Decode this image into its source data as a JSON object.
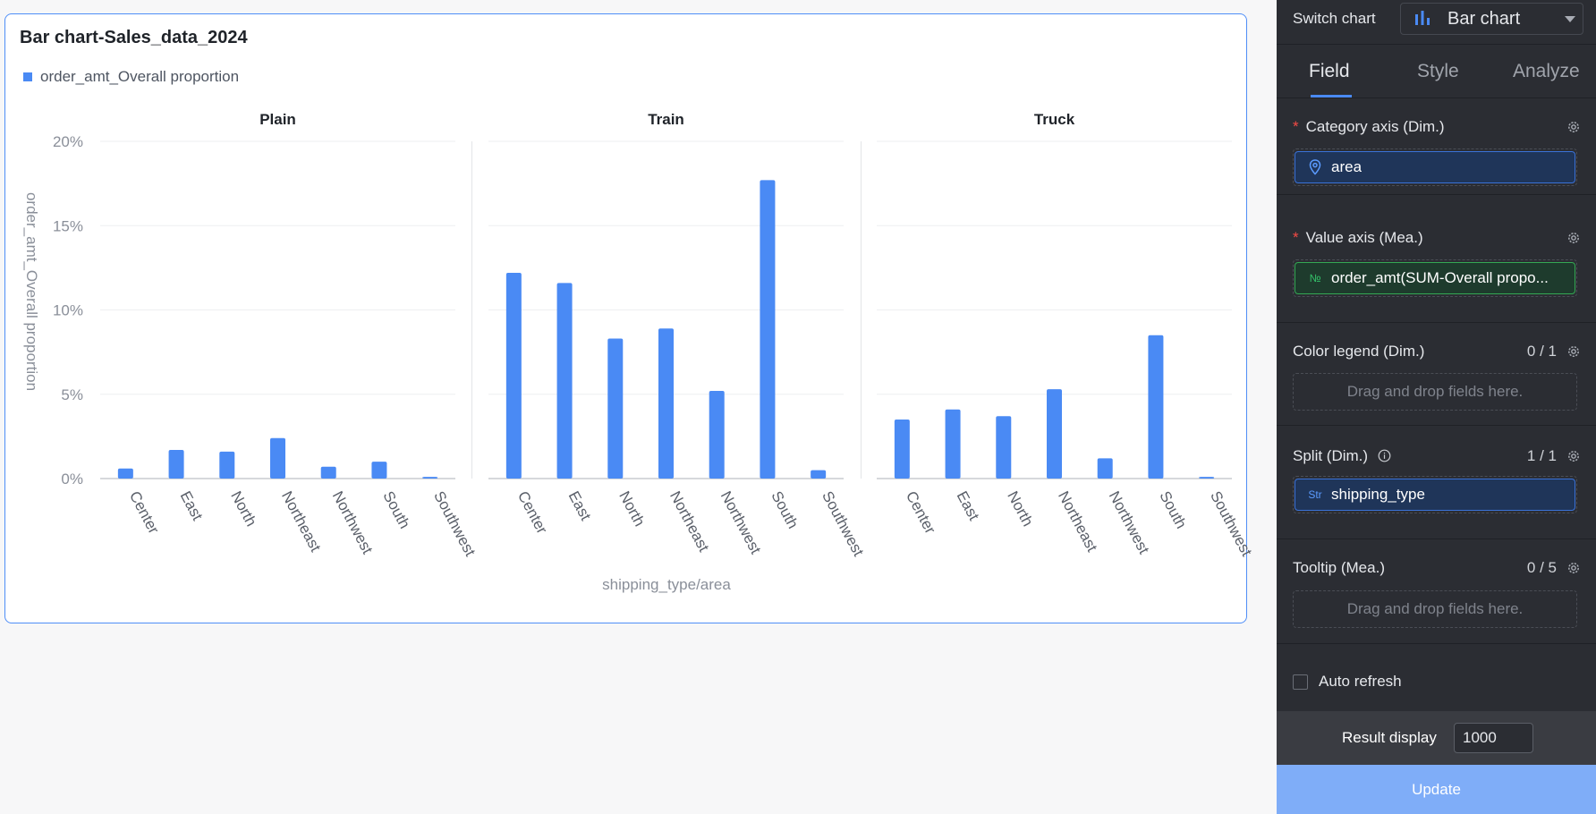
{
  "card": {
    "title": "Bar chart-Sales_data_2024",
    "legend_label": "order_amt_Overall proportion"
  },
  "chart_data": {
    "type": "bar",
    "title": "Bar chart-Sales_data_2024",
    "xlabel": "shipping_type/area",
    "ylabel": "order_amt_Overall proportion",
    "legend": "order_amt_Overall proportion",
    "ylim": [
      0,
      20
    ],
    "yticks": [
      "0%",
      "5%",
      "10%",
      "15%",
      "20%"
    ],
    "yticks_values": [
      0,
      5,
      10,
      15,
      20
    ],
    "categories": [
      "Center",
      "East",
      "North",
      "Northeast",
      "Northwest",
      "South",
      "Southwest"
    ],
    "color": "#4a8af4",
    "panels": [
      {
        "name": "Plain",
        "values": [
          0.6,
          1.7,
          1.6,
          2.4,
          0.7,
          1.0,
          0.1
        ]
      },
      {
        "name": "Train",
        "values": [
          12.2,
          11.6,
          8.3,
          8.9,
          5.2,
          17.7,
          0.5
        ]
      },
      {
        "name": "Truck",
        "values": [
          3.5,
          4.1,
          3.7,
          5.3,
          1.2,
          8.5,
          0.1
        ]
      }
    ]
  },
  "panel": {
    "switch_label": "Switch chart",
    "chart_type": "Bar chart",
    "tabs": [
      "Field",
      "Style",
      "Analyze"
    ],
    "active_tab": "Field",
    "category_axis": {
      "label": "Category axis (Dim.)",
      "field": "area"
    },
    "value_axis": {
      "label": "Value axis (Mea.)",
      "field": "order_amt(SUM-Overall propo...",
      "icon_text": "№"
    },
    "color_legend": {
      "label": "Color legend (Dim.)",
      "count": "0 / 1",
      "placeholder": "Drag and drop fields here."
    },
    "split": {
      "label": "Split (Dim.)",
      "count": "1 / 1",
      "field": "shipping_type",
      "icon_text": "Str"
    },
    "tooltip": {
      "label": "Tooltip (Mea.)",
      "count": "0 / 5",
      "placeholder": "Drag and drop fields here."
    },
    "auto_refresh_label": "Auto refresh",
    "result_display_label": "Result display",
    "result_display_value": "1000",
    "update_label": "Update"
  }
}
